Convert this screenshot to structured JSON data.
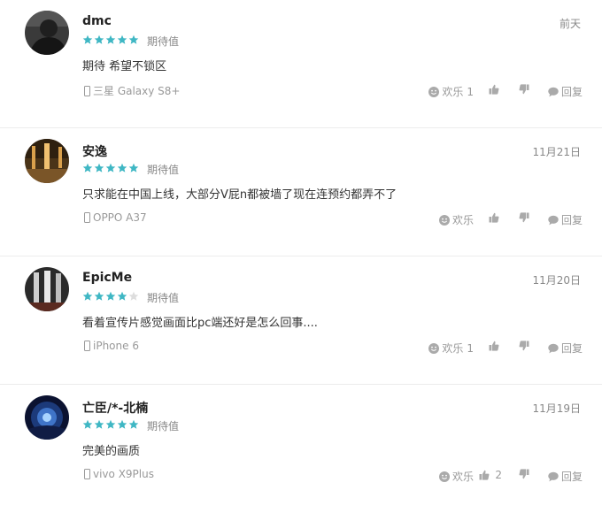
{
  "reviews": [
    {
      "user": "dmc",
      "date": "前天",
      "stars": 5,
      "rating_label": "期待值",
      "content": "期待 希望不锁区",
      "device": "三星 Galaxy S8+",
      "smile_label": "欢乐",
      "smile_count": "1",
      "like_count": "",
      "reply_label": "回复"
    },
    {
      "user": "安逸",
      "date": "11月21日",
      "stars": 5,
      "rating_label": "期待值",
      "content": "只求能在中国上线，大部分V屁n都被墙了现在连预约都弄不了",
      "device": "OPPO A37",
      "smile_label": "欢乐",
      "smile_count": "",
      "like_count": "",
      "reply_label": "回复"
    },
    {
      "user": "EpicMe",
      "date": "11月20日",
      "stars": 4,
      "rating_label": "期待值",
      "content": "看着宣传片感觉画面比pc端还好是怎么回事....",
      "device": "iPhone 6",
      "smile_label": "欢乐",
      "smile_count": "1",
      "like_count": "",
      "reply_label": "回复"
    },
    {
      "user": "亡臣/*-北楠",
      "date": "11月19日",
      "stars": 5,
      "rating_label": "期待值",
      "content": "完美的画质",
      "device": "vivo X9Plus",
      "smile_label": "欢乐",
      "smile_count": "",
      "like_count": "2",
      "reply_label": "回复"
    }
  ],
  "colors": {
    "star_filled": "#3fb7c4",
    "star_empty": "#dddddd",
    "meta_text": "#999999",
    "icon_gray": "#aaaaaa"
  }
}
